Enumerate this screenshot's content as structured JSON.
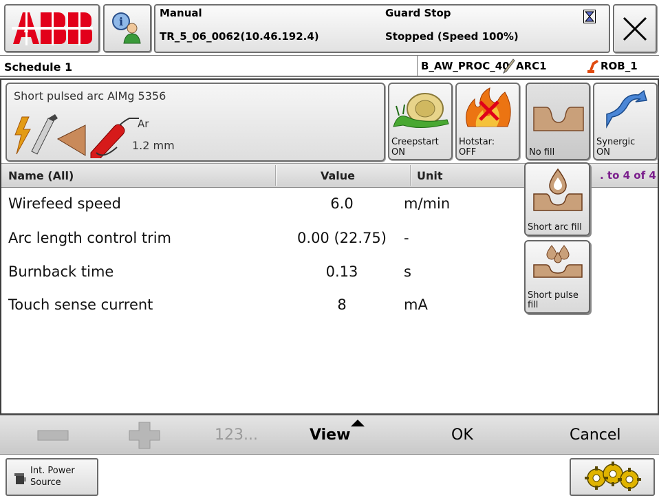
{
  "header": {
    "logo_text": "ABB",
    "mode": "Manual",
    "controller": "TR_5_06_0062(10.46.192.4)",
    "state": "Guard Stop",
    "run_status": "Stopped (Speed 100%)"
  },
  "context": {
    "schedule_title": "Schedule 1",
    "process_name": "B_AW_PROC_40",
    "arc_name": "ARC1",
    "robot_name": "ROB_1"
  },
  "process": {
    "title": "Short pulsed arc AlMg 5356",
    "gas": "Ar",
    "wire_diameter": "1.2 mm"
  },
  "toggles": {
    "creepstart": {
      "label": "Creepstart",
      "state": "ON"
    },
    "hotstart": {
      "label": "Hotstar:",
      "state": "OFF"
    },
    "fill": {
      "label": "No fill"
    },
    "synergic": {
      "label": "Synergic",
      "state": "ON"
    }
  },
  "fill_menu": {
    "options": [
      {
        "label": "Short arc fill"
      },
      {
        "label": "Short pulse fill"
      }
    ]
  },
  "table": {
    "headers": {
      "name": "Name (All)",
      "value": "Value",
      "unit": "Unit"
    },
    "counter": ". to 4 of 4",
    "rows": [
      {
        "name": "Wirefeed speed",
        "value": "6.0",
        "unit": "m/min"
      },
      {
        "name": "Arc length control trim",
        "value": "0.00 (22.75)",
        "unit": "-"
      },
      {
        "name": "Burnback time",
        "value": "0.13",
        "unit": "s"
      },
      {
        "name": "Touch sense current",
        "value": "8",
        "unit": "mA"
      }
    ]
  },
  "commands": {
    "numpad": "123...",
    "view": "View",
    "ok": "OK",
    "cancel": "Cancel"
  },
  "footer": {
    "power_source_label": "Int. Power Source"
  },
  "colors": {
    "abb_red": "#e2001a",
    "counter_purple": "#7a1e8c"
  },
  "icons": {
    "creepstart": "snail-icon",
    "hotstart": "fire-icon",
    "fill": "weld-groove-icon",
    "synergic": "synergic-curve-icon",
    "power_source": "power-source-icon",
    "quickset": "gears-icon"
  }
}
